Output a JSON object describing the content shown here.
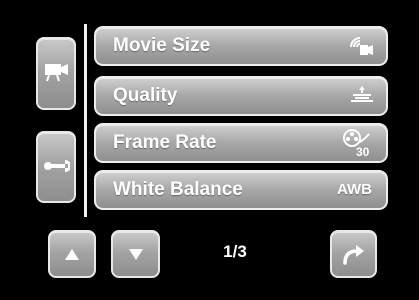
{
  "menu": {
    "items": [
      {
        "label": "Movie Size",
        "icon": "movie-size-icon"
      },
      {
        "label": "Quality",
        "icon": "quality-icon"
      },
      {
        "label": "Frame Rate",
        "icon": "frame-rate-icon",
        "value": "30"
      },
      {
        "label": "White Balance",
        "value": "AWB"
      }
    ]
  },
  "sidebar": {
    "items": [
      {
        "name": "movie-camera",
        "icon": "movie-camera-icon"
      },
      {
        "name": "setup",
        "icon": "wrench-icon"
      }
    ]
  },
  "pager": {
    "text": "1/3"
  },
  "nav": {
    "up_icon": "up-arrow-icon",
    "down_icon": "down-arrow-icon",
    "forward_icon": "curved-arrow-icon"
  },
  "colors": {
    "background": "#000000",
    "button_gradient_top": "#c9c9c9",
    "button_gradient_bottom": "#8d8d8d",
    "border": "#e8e8e8",
    "text": "#ffffff"
  }
}
